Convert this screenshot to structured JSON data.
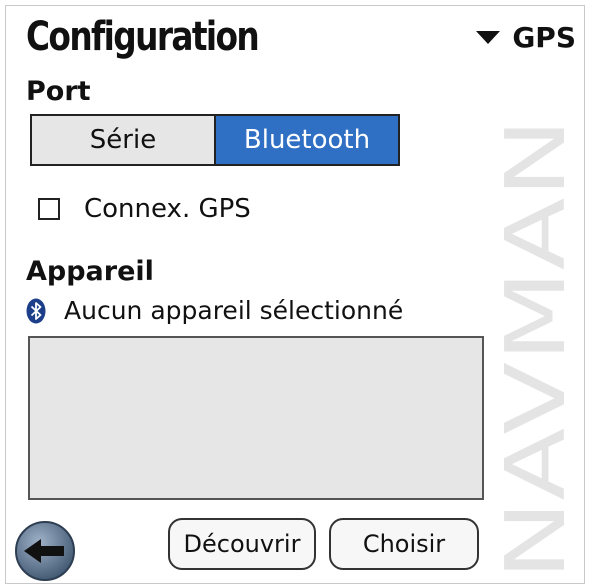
{
  "header": {
    "title": "Configuration",
    "menu_label": "GPS",
    "menu_icon": "triangle-down-icon"
  },
  "port": {
    "label": "Port",
    "options": [
      "Série",
      "Bluetooth"
    ],
    "selected": "Bluetooth"
  },
  "gps_connection": {
    "label": "Connex. GPS",
    "checked": false
  },
  "device": {
    "label": "Appareil",
    "status_icon": "bluetooth-icon",
    "status_text": "Aucun appareil sélectionné",
    "list_items": []
  },
  "footer": {
    "back_icon": "back-arrow-icon",
    "discover_label": "Découvrir",
    "choose_label": "Choisir"
  },
  "brand": {
    "watermark": "NAVMAN"
  },
  "colors": {
    "accent": "#2f6fc4",
    "panel": "#e6e6e6"
  }
}
